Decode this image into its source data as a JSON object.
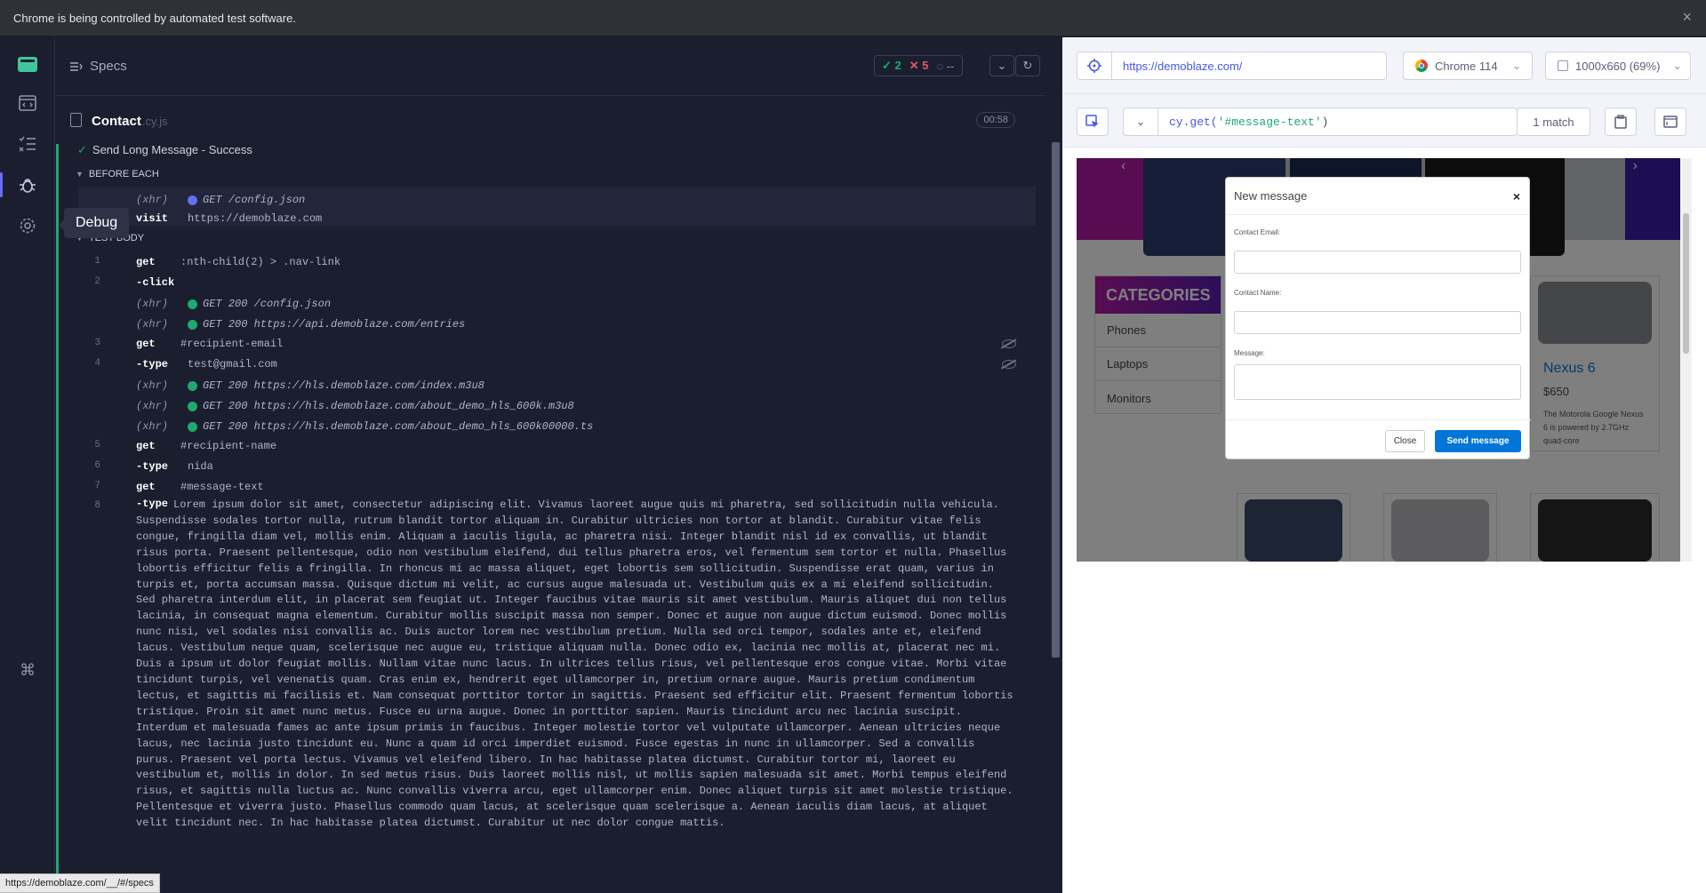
{
  "banner": {
    "text": "Chrome is being controlled by automated test software.",
    "close": "×"
  },
  "tooltip": "Debug",
  "status_url": "https://demoblaze.com/__/#/specs",
  "specs_header": {
    "title": "Specs",
    "passed": "2",
    "failed": "5",
    "pending": "--"
  },
  "spec_file": {
    "name": "Contact",
    "ext": ".cy.js",
    "duration": "00:58"
  },
  "test": {
    "title": "Send Long Message - Success"
  },
  "sections": {
    "before_each": "BEFORE EACH",
    "test_body": "TEST BODY"
  },
  "before_each_cmds": [
    {
      "type": "(xhr)",
      "msg": "GET /config.json"
    },
    {
      "name": "visit",
      "msg": "https://demoblaze.com"
    }
  ],
  "commands": [
    {
      "num": "1",
      "name": "get",
      "msg": ":nth-child(2) > .nav-link"
    },
    {
      "num": "2",
      "name": "-click",
      "msg": ""
    },
    {
      "type": "(xhr)",
      "msg": "GET 200 /config.json"
    },
    {
      "type": "(xhr)",
      "msg": "GET 200 https://api.demoblaze.com/entries"
    },
    {
      "num": "3",
      "name": "get",
      "msg": "#recipient-email"
    },
    {
      "num": "4",
      "name": "-type",
      "msg": "test@gmail.com"
    },
    {
      "type": "(xhr)",
      "msg": "GET 200 https://hls.demoblaze.com/index.m3u8"
    },
    {
      "type": "(xhr)",
      "msg": "GET 200 https://hls.demoblaze.com/about_demo_hls_600k.m3u8"
    },
    {
      "type": "(xhr)",
      "msg": "GET 200 https://hls.demoblaze.com/about_demo_hls_600k00000.ts"
    },
    {
      "num": "5",
      "name": "get",
      "msg": "#recipient-name"
    },
    {
      "num": "6",
      "name": "-type",
      "msg": "nida"
    },
    {
      "num": "7",
      "name": "get",
      "msg": "#message-text"
    }
  ],
  "long_cmd": {
    "num": "8",
    "name": "-type",
    "msg": "Lorem ipsum dolor sit amet, consectetur adipiscing elit. Vivamus laoreet augue quis mi pharetra, sed sollicitudin nulla vehicula. Suspendisse sodales tortor nulla, rutrum blandit tortor aliquam in. Curabitur ultricies non tortor at blandit. Curabitur vitae felis congue, fringilla diam vel, mollis enim. Aliquam a iaculis ligula, ac pharetra nisi. Integer blandit nisl id ex convallis, ut blandit risus porta. Praesent pellentesque, odio non vestibulum eleifend, dui tellus pharetra eros, vel fermentum sem tortor et nulla. Phasellus lobortis efficitur felis a fringilla. In rhoncus mi ac massa aliquet, eget lobortis sem sollicitudin. Suspendisse erat quam, varius in turpis et, porta accumsan massa. Quisque dictum mi velit, ac cursus augue malesuada ut. Vestibulum quis ex a mi eleifend sollicitudin. Sed pharetra interdum elit, in placerat sem feugiat ut. Integer faucibus vitae mauris sit amet vestibulum. Mauris aliquet dui non tellus lacinia, in consequat magna elementum. Curabitur mollis suscipit massa non semper. Donec et augue non augue dictum euismod. Donec mollis nunc nisi, vel sodales nisi convallis ac. Duis auctor lorem nec vestibulum pretium. Nulla sed orci tempor, sodales ante et, eleifend lacus. Vestibulum neque quam, scelerisque nec augue eu, tristique aliquam nulla. Donec odio ex, lacinia nec mollis at, placerat nec mi. Duis a ipsum ut dolor feugiat mollis. Nullam vitae nunc lacus. In ultrices tellus risus, vel pellentesque eros congue vitae. Morbi vitae tincidunt turpis, vel venenatis quam. Cras enim ex, hendrerit eget ullamcorper in, pretium ornare augue. Mauris pretium condimentum lectus, et sagittis mi facilisis et. Nam consequat porttitor tortor in sagittis. Praesent sed efficitur elit. Praesent fermentum lobortis tristique. Proin sit amet nunc metus. Fusce eu urna augue. Donec in porttitor sapien. Mauris tincidunt arcu nec lacinia suscipit. Interdum et malesuada fames ac ante ipsum primis in faucibus. Integer molestie tortor vel vulputate ullamcorper. Aenean ultricies neque lacus, nec lacinia justo tincidunt eu. Nunc a quam id orci imperdiet euismod. Fusce egestas in nunc in ullamcorper. Sed a convallis purus. Praesent vel porta lectus. Vivamus vel eleifend libero. In hac habitasse platea dictumst. Curabitur tortor mi, laoreet eu vestibulum et, mollis in dolor. In sed metus risus. Duis laoreet mollis nisl, ut mollis sapien malesuada sit amet. Morbi tempus eleifend risus, et sagittis nulla luctus ac. Nunc convallis viverra arcu, eget ullamcorper enim. Donec aliquet turpis sit amet molestie tristique. Pellentesque et viverra justo. Phasellus commodo quam lacus, at scelerisque quam scelerisque a. Aenean iaculis diam lacus, at aliquet velit tincidunt nec. In hac habitasse platea dictumst. Curabitur ut nec dolor congue mattis."
  },
  "aut": {
    "url": "https://demoblaze.com/",
    "browser": "Chrome 114",
    "viewport": "1000x660 (69%)",
    "selector_prefix": "cy.get(",
    "selector_str": "'#message-text'",
    "selector_suffix": ")",
    "match": "1 match"
  },
  "site": {
    "categories_title": "CATEGORIES",
    "categories": [
      "Phones",
      "Laptops",
      "Monitors"
    ],
    "product_name": "Nexus 6",
    "product_price": "$650",
    "product_desc": "The Motorola Google Nexus 6 is powered by 2.7GHz quad-core",
    "modal": {
      "title": "New message",
      "close_x": "×",
      "email_label": "Contact Email:",
      "name_label": "Contact Name:",
      "message_label": "Message:",
      "close_btn": "Close",
      "send_btn": "Send message"
    }
  },
  "colors": {
    "pass": "#1fa971",
    "fail": "#e45770",
    "accent": "#6470f3",
    "send": "#0275d8"
  }
}
